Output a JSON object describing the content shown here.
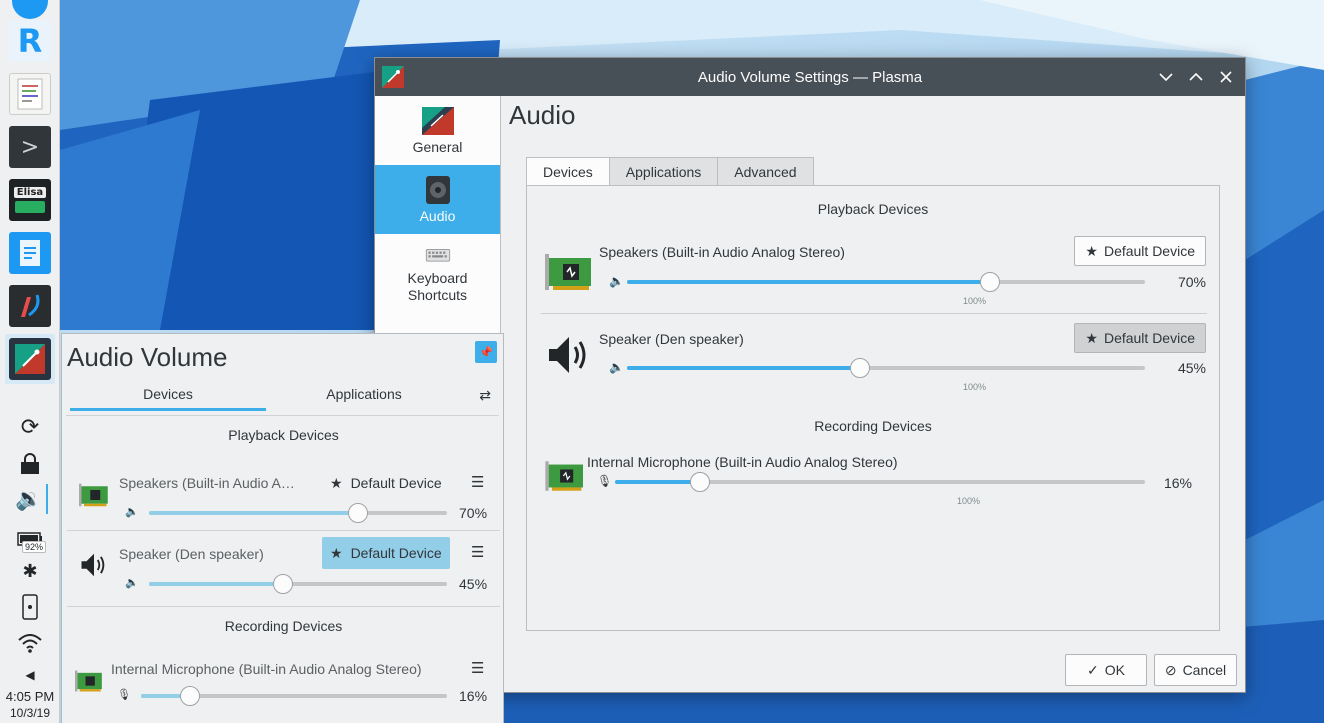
{
  "window": {
    "title": "Audio Volume Settings — Plasma",
    "page_title": "Audio",
    "sidebar": [
      {
        "label": "General",
        "icon": "general-icon",
        "active": false
      },
      {
        "label": "Audio",
        "icon": "speaker-icon",
        "active": true
      },
      {
        "label": "Keyboard\nShortcuts",
        "icon": "keyboard-icon",
        "active": false
      }
    ],
    "tabs": [
      "Devices",
      "Applications",
      "Advanced"
    ],
    "active_tab": "Devices",
    "playback_title": "Playback Devices",
    "recording_title": "Recording Devices",
    "playback": [
      {
        "name": "Speakers (Built-in Audio Analog Stereo)",
        "default_label": "Default Device",
        "is_default": false,
        "volume": 70,
        "volume_label": "70%",
        "marker": "100%"
      },
      {
        "name": "Speaker (Den speaker)",
        "default_label": "Default Device",
        "is_default": true,
        "volume": 45,
        "volume_label": "45%",
        "marker": "100%"
      }
    ],
    "recording": [
      {
        "name": "Internal Microphone (Built-in Audio Analog Stereo)",
        "volume": 16,
        "volume_label": "16%",
        "marker": "100%"
      }
    ],
    "ok_label": "OK",
    "cancel_label": "Cancel"
  },
  "popup": {
    "title": "Audio Volume",
    "tabs": [
      "Devices",
      "Applications"
    ],
    "active_tab": "Devices",
    "playback_title": "Playback Devices",
    "recording_title": "Recording Devices",
    "playback": [
      {
        "name": "Speakers (Built-in Audio A…",
        "default_label": "Default Device",
        "is_default": false,
        "volume": 70,
        "volume_label": "70%"
      },
      {
        "name": "Speaker (Den speaker)",
        "default_label": "Default Device",
        "is_default": true,
        "volume": 45,
        "volume_label": "45%"
      }
    ],
    "recording": [
      {
        "name": "Internal Microphone (Built-in Audio Analog Stereo)",
        "volume": 16,
        "volume_label": "16%"
      }
    ]
  },
  "panel": {
    "launchers": [
      "krunner-icon",
      "text-editor-icon",
      "terminal-icon",
      "elisa-icon",
      "document-icon",
      "krita-icon",
      "audio-settings-icon"
    ],
    "elisa_label": "Elisa",
    "battery": "92%",
    "time": "4:05 PM",
    "date": "10/3/19"
  },
  "colors": {
    "accent": "#3daee9",
    "titlebar": "#475057",
    "window_bg": "#eff0f1"
  }
}
